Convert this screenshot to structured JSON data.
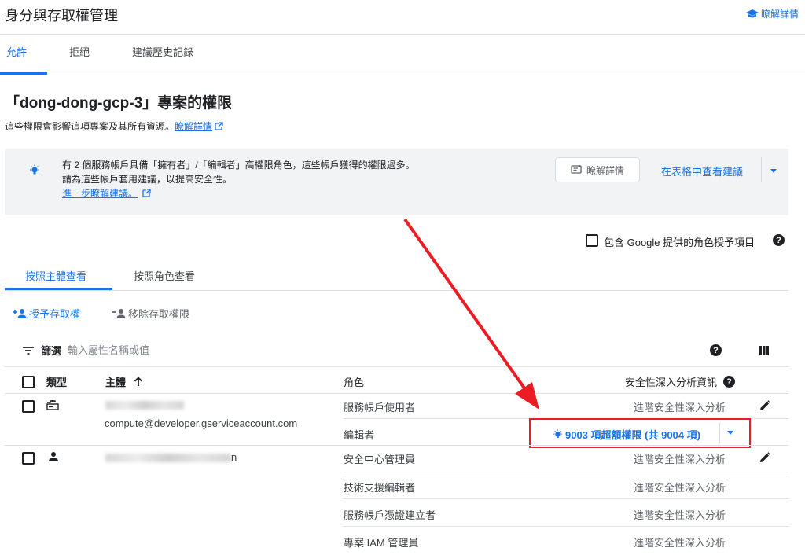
{
  "header": {
    "title": "身分與存取權管理",
    "learn_more": "瞭解詳情"
  },
  "tabs": [
    "允許",
    "拒絕",
    "建議歷史記錄"
  ],
  "page": {
    "title": "「dong-dong-gcp-3」專案的權限",
    "desc": "這些權限會影響這項專案及其所有資源。",
    "desc_link": "瞭解詳情"
  },
  "banner": {
    "line1": "有 2 個服務帳戶具備「擁有者」/「編輯者」高權限角色，這些帳戶獲得的權限過多。",
    "line2": "請為這些帳戶套用建議，以提高安全性。",
    "link": "進一步瞭解建議。",
    "learn_button": "瞭解詳情",
    "table_button": "在表格中查看建議"
  },
  "include_google": "包含 Google 提供的角色授予項目",
  "subtabs": [
    "按照主體查看",
    "按照角色查看"
  ],
  "actions": {
    "grant": "授予存取權",
    "remove": "移除存取權限"
  },
  "filter": {
    "label": "篩選",
    "placeholder": "輸入屬性名稱或值"
  },
  "table": {
    "headers": {
      "type": "類型",
      "principal": "主體",
      "role": "角色",
      "insights": "安全性深入分析資訊"
    },
    "rows": [
      {
        "principal_email": "compute@developer.gserviceaccount.com",
        "roles": [
          {
            "name": "服務帳戶使用者",
            "insight": "進階安全性深入分析"
          },
          {
            "name": "編輯者",
            "insight": "9003 項超額權限 (共 9004 項)"
          }
        ]
      },
      {
        "principal_email": "n",
        "roles": [
          {
            "name": "安全中心管理員",
            "insight": "進階安全性深入分析"
          },
          {
            "name": "技術支援編輯者",
            "insight": "進階安全性深入分析"
          },
          {
            "name": "服務帳戶憑證建立者",
            "insight": "進階安全性深入分析"
          },
          {
            "name": "專案 IAM 管理員",
            "insight": "進階安全性深入分析"
          }
        ]
      }
    ]
  },
  "icons": {
    "learn": "graduation-cap-icon",
    "external": "external-link-icon",
    "bulb": "lightbulb-icon",
    "sort": "arrow-up-icon",
    "help": "help-icon",
    "columns": "column-display-icon",
    "edit": "pencil-icon",
    "filter": "filter-icon",
    "service_account": "service-account-icon",
    "person": "person-icon"
  },
  "colors": {
    "accent": "#1a73e8",
    "annotation": "#ea1c24"
  }
}
